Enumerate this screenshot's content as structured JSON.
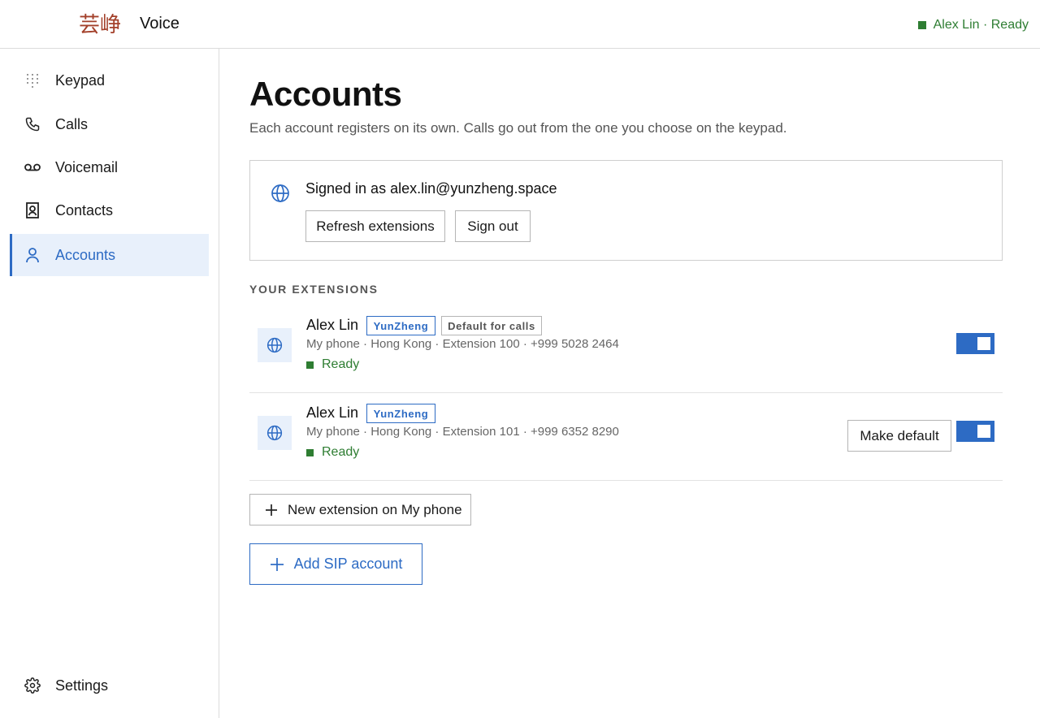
{
  "app": {
    "logo_text": "芸峥",
    "name": "Voice",
    "user_status": "Alex Lin · Ready",
    "colors": {
      "accent": "#2d6bc4",
      "ready": "#2e7d32",
      "logo": "#a3402a"
    }
  },
  "sidebar": {
    "items": [
      {
        "label": "Keypad",
        "icon": "keypad-icon"
      },
      {
        "label": "Calls",
        "icon": "phone-icon"
      },
      {
        "label": "Voicemail",
        "icon": "voicemail-icon"
      },
      {
        "label": "Contacts",
        "icon": "contact-card-icon"
      },
      {
        "label": "Accounts",
        "icon": "person-icon",
        "active": true
      }
    ],
    "settings": {
      "label": "Settings",
      "icon": "gear-icon"
    }
  },
  "main": {
    "title": "Accounts",
    "subtitle": "Each account registers on its own. Calls go out from the one you choose on the keypad.",
    "signin": {
      "text": "Signed in as alex.lin@yunzheng.space",
      "refresh_label": "Refresh extensions",
      "signout_label": "Sign out"
    },
    "section_label": "YOUR EXTENSIONS",
    "extensions": [
      {
        "name": "Alex Lin",
        "org_tag": "YunZheng",
        "default_tag": "Default for calls",
        "detail": "My phone · Hong Kong · Extension 100 · +999 5028 2464",
        "status": "Ready",
        "enabled": true
      },
      {
        "name": "Alex Lin",
        "org_tag": "YunZheng",
        "detail": "My phone · Hong Kong · Extension 101 · +999 6352 8290",
        "status": "Ready",
        "make_default_label": "Make default",
        "enabled": true
      }
    ],
    "new_extension_label": "New extension on My phone",
    "add_sip_label": "Add SIP account"
  }
}
